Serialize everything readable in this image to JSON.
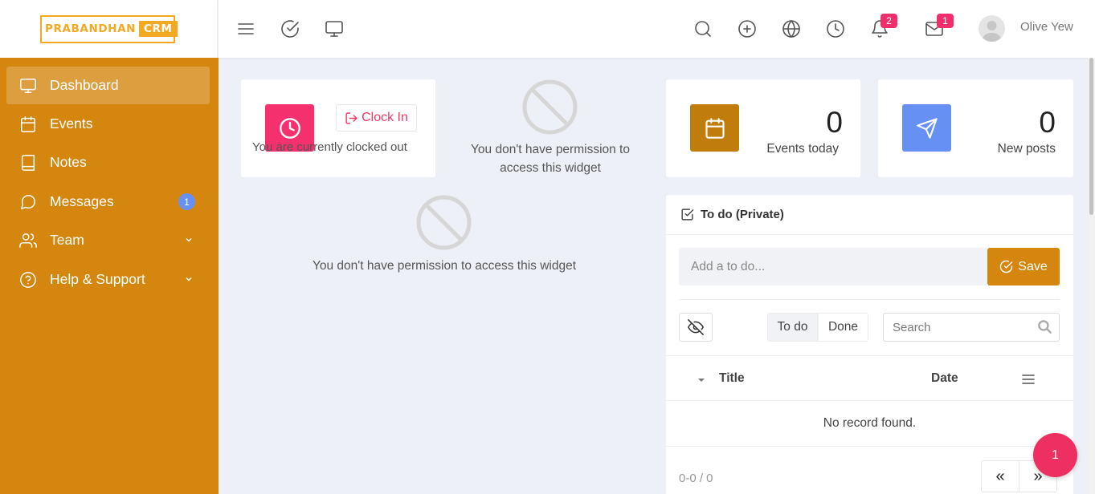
{
  "brand": {
    "part1": "PRABANDHAN",
    "part2": "CRM",
    "color": "#f3a922"
  },
  "sidebar": {
    "bg": "#d4860e",
    "items": [
      {
        "label": "Dashboard",
        "icon": "monitor-icon",
        "active": true
      },
      {
        "label": "Events",
        "icon": "calendar-icon"
      },
      {
        "label": "Notes",
        "icon": "book-icon"
      },
      {
        "label": "Messages",
        "icon": "message-circle-icon",
        "badge": "1"
      },
      {
        "label": "Team",
        "icon": "users-icon"
      },
      {
        "label": "Help & Support",
        "icon": "help-circle-icon"
      }
    ]
  },
  "topbar": {
    "left_icons": [
      "menu-icon",
      "check-circle-icon",
      "monitor-icon"
    ],
    "right_icons": [
      "search-icon",
      "plus-circle-icon",
      "globe-icon",
      "clock-icon",
      "bell-icon",
      "mail-icon"
    ],
    "notifications_badge": "2",
    "messages_badge": "1",
    "user_name": "Olive Yew",
    "badge_color": "#ee2f6a"
  },
  "clock_widget": {
    "button_label": "Clock In",
    "status": "You are currently clocked out"
  },
  "permission_widget_1": {
    "text": "You don't have permission to access this widget"
  },
  "permission_widget_2": {
    "text": "You don't have permission to access this widget"
  },
  "events_today": {
    "value": "0",
    "label": "Events today",
    "color": "#c07d0c"
  },
  "new_posts": {
    "value": "0",
    "label": "New posts",
    "color": "#6690f4"
  },
  "todo": {
    "title": "To do (Private)",
    "input_placeholder": "Add a to do...",
    "save_label": "Save",
    "tabs": [
      "To do",
      "Done"
    ],
    "search_placeholder": "Search",
    "columns": {
      "title": "Title",
      "date": "Date"
    },
    "empty_text": "No record found.",
    "pager_info": "0-0 / 0",
    "prev_label": "«",
    "next_label": "»"
  },
  "fab": {
    "label": "1"
  }
}
